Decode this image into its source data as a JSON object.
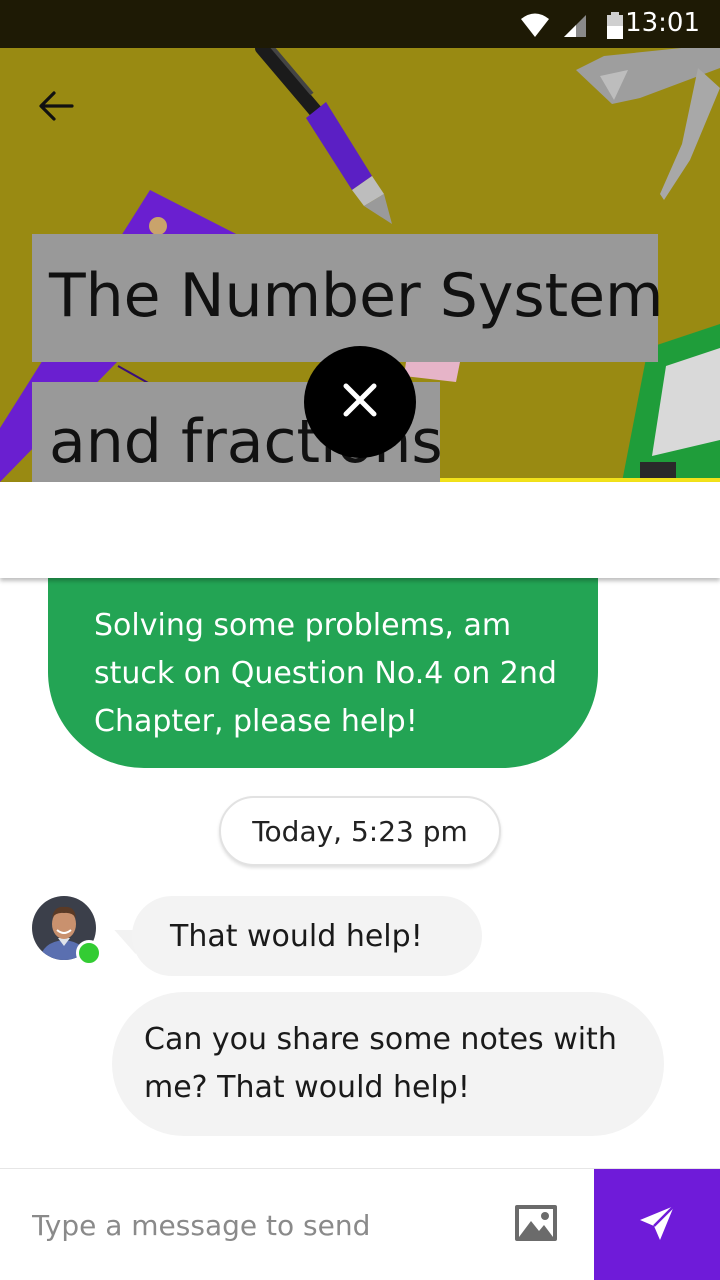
{
  "status_bar": {
    "time": "13:01",
    "icons": [
      "wifi-icon",
      "cellular-signal-icon",
      "battery-icon"
    ]
  },
  "header": {
    "back_icon": "arrow-left-icon",
    "title_line_1": "The Number System",
    "title_line_2": "and fractions",
    "close_icon": "close-icon"
  },
  "chat": {
    "sent_message": "Solving some problems, am stuck on Question No.4 on 2nd Chapter, please help!",
    "timestamp": "Today, 5:23 pm",
    "received_messages": [
      "That would help!",
      "Can you share some notes with me? That would help!"
    ]
  },
  "composer": {
    "placeholder": "Type a message to send",
    "image_icon": "image-icon",
    "send_icon": "send-icon"
  },
  "colors": {
    "hero_background": "#998a12",
    "sent_bubble": "#23a454",
    "received_bubble": "#f3f3f3",
    "send_button": "#6f1bd9",
    "online_indicator": "#33cc33"
  }
}
